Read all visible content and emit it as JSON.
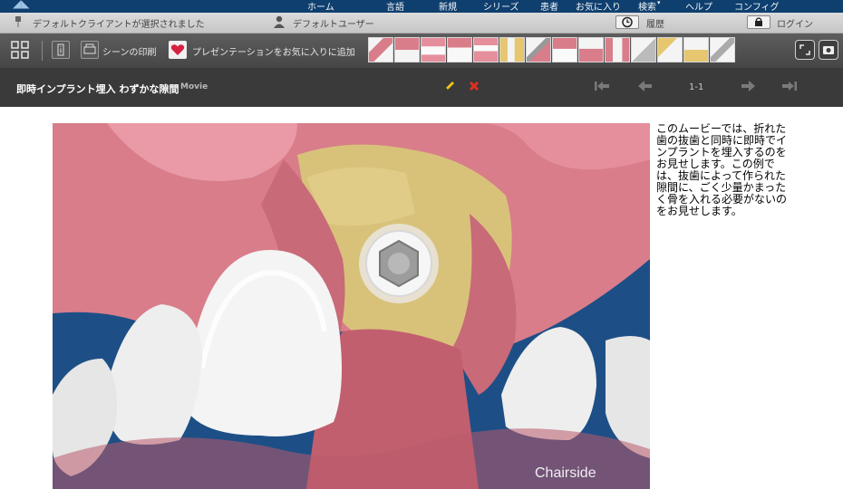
{
  "top_nav": {
    "items": [
      "ホーム",
      "言語",
      "新規",
      "シリーズ",
      "患者",
      "お気に入り",
      "検索",
      "ヘルプ",
      "コンフィグ"
    ]
  },
  "status_bar": {
    "client_text": "デフォルトクライアントが選択されました",
    "user_text": "デフォルトユーザー",
    "history_label": "履歴",
    "login_label": "ログイン"
  },
  "toolbar": {
    "print_label": "シーンの印刷",
    "favorite_label": "プレゼンテーションをお気に入りに追加",
    "thumbnail_count": 16
  },
  "title_bar": {
    "title": "即時インプラント埋入 わずかな隙間",
    "type_label": "Movie",
    "pager": "1-1"
  },
  "movie": {
    "watermark": "Chairside"
  },
  "description": "このムービーでは、折れた歯の抜歯と同時に即時でインプラントを埋入するのをお見せします。この例では、抜歯によって作られた隙間に、ごく少量かまったく骨を入れる必要がないのをお見せします。",
  "colors": {
    "nav_bg": "#0f3f6e",
    "toolbar_bg": "#4f4f4f",
    "titlebar_bg": "#3a3a3a",
    "gum": "#d97d8a",
    "bone": "#d8c27a",
    "tooth": "#f4f4f4"
  }
}
